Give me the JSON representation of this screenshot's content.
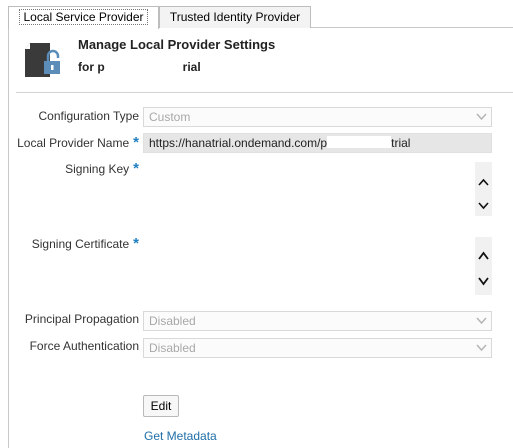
{
  "tabs": {
    "local": "Local Service Provider",
    "trusted": "Trusted Identity Provider"
  },
  "header": {
    "title": "Manage Local Provider Settings",
    "subtitle_prefix": "for p",
    "subtitle_suffix": "rial"
  },
  "form": {
    "configuration_type": {
      "label": "Configuration Type",
      "value": "Custom"
    },
    "local_provider_name": {
      "label": "Local Provider Name",
      "value_prefix": "https://hanatrial.ondemand.com/p",
      "value_suffix": "trial",
      "required_marker": "*"
    },
    "signing_key": {
      "label": "Signing Key",
      "required_marker": "*"
    },
    "signing_certificate": {
      "label": "Signing Certificate",
      "required_marker": "*"
    },
    "principal_propagation": {
      "label": "Principal Propagation",
      "value": "Disabled"
    },
    "force_authentication": {
      "label": "Force Authentication",
      "value": "Disabled"
    }
  },
  "actions": {
    "edit": "Edit",
    "get_metadata": "Get Metadata"
  },
  "icons": {
    "header": "document-lock-icon",
    "dropdown": "chevron-down-icon",
    "scroll_up": "scroll-up-icon",
    "scroll_down": "scroll-down-icon"
  },
  "colors": {
    "required": "#1f7fc1",
    "link": "#1f6ea8",
    "readonly_field": "#e6e6e6",
    "icon_lock": "#5b8db8"
  }
}
